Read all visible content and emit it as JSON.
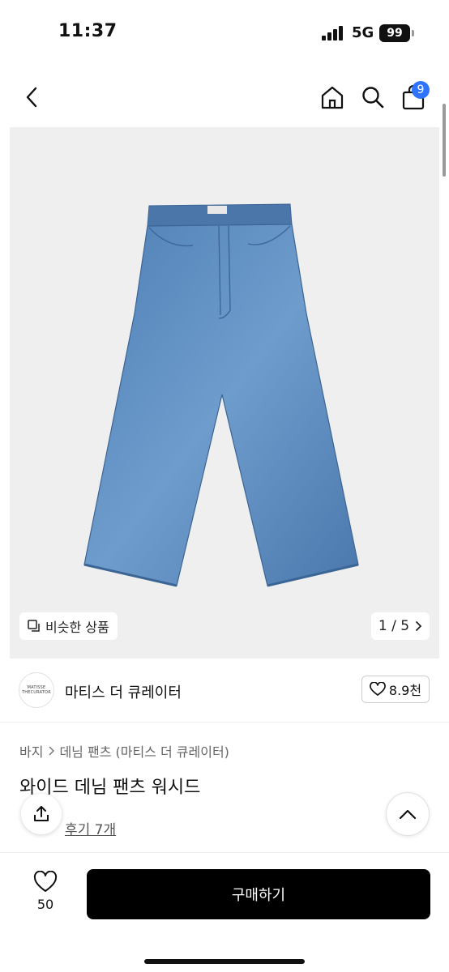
{
  "status_bar": {
    "time": "11:37",
    "network": "5G",
    "battery": "99"
  },
  "nav": {
    "back_icon": "chevron-left-icon",
    "home_icon": "home-icon",
    "search_icon": "search-icon",
    "cart_icon": "shopping-bag-icon",
    "cart_count": "9",
    "badge_color": "#2f74ff"
  },
  "gallery": {
    "similar_label": "비슷한 상품",
    "pager": "1 / 5",
    "background": "#efefef"
  },
  "seller": {
    "logo_line1": "MATISSE",
    "logo_line2": "THECURATOR",
    "name": "마티스 더 큐레이터",
    "likes": "8.9천"
  },
  "product": {
    "breadcrumb": [
      "바지",
      "데님 팬츠 (마티스 더 큐레이터)"
    ],
    "title": "와이드 데님 팬츠 워시드",
    "reviews_label": "후기 7개"
  },
  "bottom_bar": {
    "wish_count": "50",
    "buy_label": "구매하기",
    "buy_color": "#000000"
  }
}
